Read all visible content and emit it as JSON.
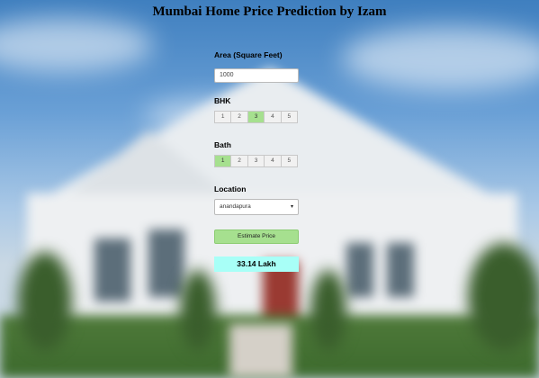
{
  "page": {
    "title": "Mumbai Home Price Prediction by Izam"
  },
  "form": {
    "area": {
      "label": "Area (Square Feet)",
      "value": "1000"
    },
    "bhk": {
      "label": "BHK",
      "options": [
        "1",
        "2",
        "3",
        "4",
        "5"
      ],
      "selected": "3"
    },
    "bath": {
      "label": "Bath",
      "options": [
        "1",
        "2",
        "3",
        "4",
        "5"
      ],
      "selected": "1"
    },
    "location": {
      "label": "Location",
      "selected": "anandapura"
    },
    "estimate_button": "Estimate Price",
    "result": "33.14 Lakh"
  },
  "colors": {
    "accent_green": "#a6e08f",
    "result_bg": "#a8fff7"
  }
}
